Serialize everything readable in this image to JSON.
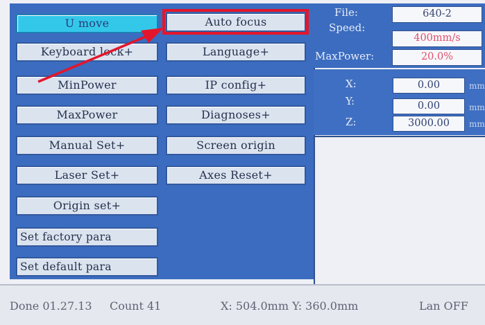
{
  "menu": {
    "u_move": "U move",
    "auto_focus": "Auto focus",
    "keyboard_lock": "Keyboard lock+",
    "language": "Language+",
    "min_power": "MinPower",
    "ip_config": "IP config+",
    "max_power": "MaxPower",
    "diagnoses": "Diagnoses+",
    "manual_set": "Manual Set+",
    "screen_origin": "Screen origin",
    "laser_set": "Laser Set+",
    "axes_reset": "Axes Reset+",
    "origin_set": "Origin set+",
    "set_factory_para": "Set factory para",
    "set_default_para": "Set default para"
  },
  "info": {
    "file_label": "File:",
    "file_value": "640-2",
    "speed_label": "Speed:",
    "speed_value": "400mm/s",
    "maxpower_label": "MaxPower:",
    "maxpower_value": "20.0%"
  },
  "axes": {
    "x_label": "X:",
    "x_value": "0.00",
    "y_label": "Y:",
    "y_value": "0.00",
    "z_label": "Z:",
    "z_value": "3000.00",
    "unit": "mm"
  },
  "status": {
    "done": "Done 01.27.13",
    "count": "Count    41",
    "position": "X: 504.0mm Y: 360.0mm",
    "lan": "Lan OFF"
  },
  "colors": {
    "panel_blue": "#3b6cc0",
    "selected_cyan": "#33c8ea",
    "highlight_red": "#e3162b"
  }
}
